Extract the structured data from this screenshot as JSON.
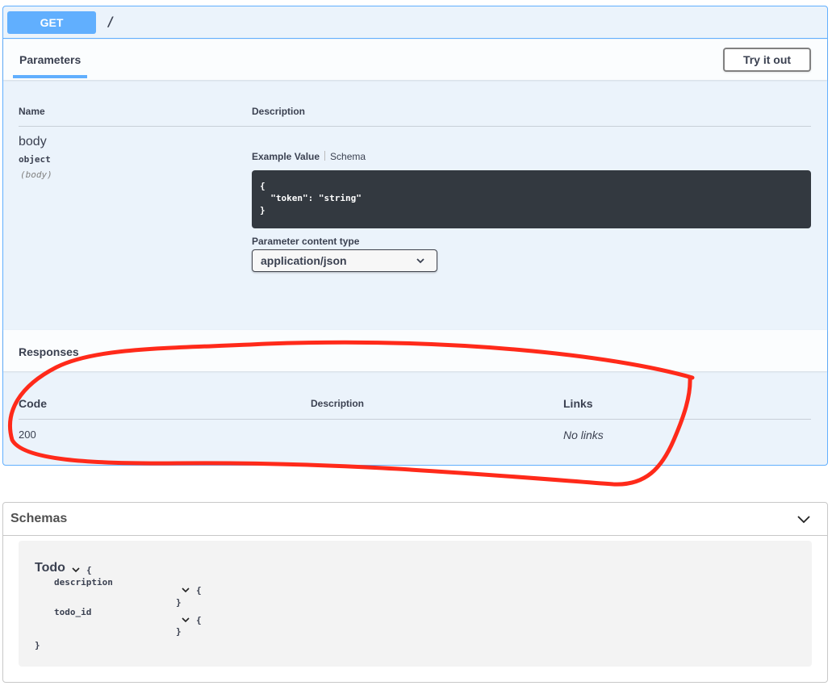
{
  "operation": {
    "method": "GET",
    "path": "/"
  },
  "parameters": {
    "tab_label": "Parameters",
    "try_button": "Try it out",
    "col_name": "Name",
    "col_description": "Description",
    "param": {
      "name": "body",
      "type": "object",
      "in": "(body)"
    },
    "example_tab": "Example Value",
    "schema_tab": "Schema",
    "example_code": "{\n  \"token\": \"string\"\n}",
    "content_type_label": "Parameter content type",
    "content_type_value": "application/json"
  },
  "responses": {
    "title": "Responses",
    "col_code": "Code",
    "col_description": "Description",
    "col_links": "Links",
    "rows": [
      {
        "code": "200",
        "links": "No links"
      }
    ]
  },
  "schemas": {
    "title": "Schemas",
    "model": {
      "name": "Todo",
      "open_brace": "{",
      "close_brace": "}",
      "properties": [
        {
          "name": "description",
          "open": "{",
          "close": "}"
        },
        {
          "name": "todo_id",
          "open": "{",
          "close": "}"
        }
      ]
    }
  },
  "colors": {
    "get_accent": "#61affe",
    "opblock_bg": "#ebf3fb",
    "code_bg": "#333940",
    "annotation": "#ff2a1a"
  }
}
